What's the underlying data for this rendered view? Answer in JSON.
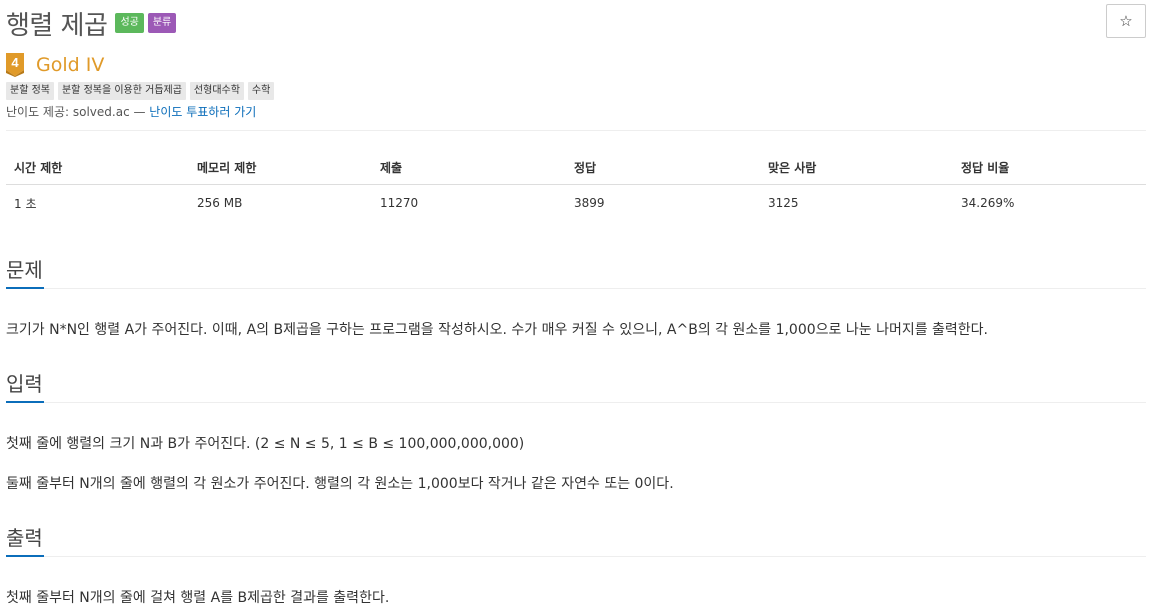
{
  "problem": {
    "title": "행렬 제곱",
    "badges": [
      "성공",
      "분류"
    ],
    "star_label": "☆",
    "tier_number": "4",
    "tier_name": "Gold IV",
    "tags": [
      "분할 정복",
      "분할 정복을 이용한 거듭제곱",
      "선형대수학",
      "수학"
    ],
    "credit_prefix": "난이도 제공: solved.ac — ",
    "credit_link": "난이도 투표하러 가기"
  },
  "info_table": {
    "headers": [
      "시간 제한",
      "메모리 제한",
      "제출",
      "정답",
      "맞은 사람",
      "정답 비율"
    ],
    "values": [
      "1 초",
      "256 MB",
      "11270",
      "3899",
      "3125",
      "34.269%"
    ]
  },
  "sections": {
    "problem_title": "문제",
    "problem_text": "크기가 N*N인 행렬 A가 주어진다. 이때, A의 B제곱을 구하는 프로그램을 작성하시오. 수가 매우 커질 수 있으니, A^B의 각 원소를 1,000으로 나눈 나머지를 출력한다.",
    "input_title": "입력",
    "input_text_1": "첫째 줄에 행렬의 크기 N과 B가 주어진다. (2 ≤ N ≤  5, 1 ≤ B ≤ 100,000,000,000)",
    "input_text_2": "둘째 줄부터 N개의 줄에 행렬의 각 원소가 주어진다. 행렬의 각 원소는 1,000보다 작거나 같은 자연수 또는 0이다.",
    "output_title": "출력",
    "output_text": "첫째 줄부터 N개의 줄에 걸쳐 행렬 A를 B제곱한 결과를 출력한다."
  },
  "colors": {
    "success_badge": "#5cb85c",
    "category_badge": "#9c59b6",
    "gold": "#e09a29",
    "link": "#0b6dba"
  }
}
